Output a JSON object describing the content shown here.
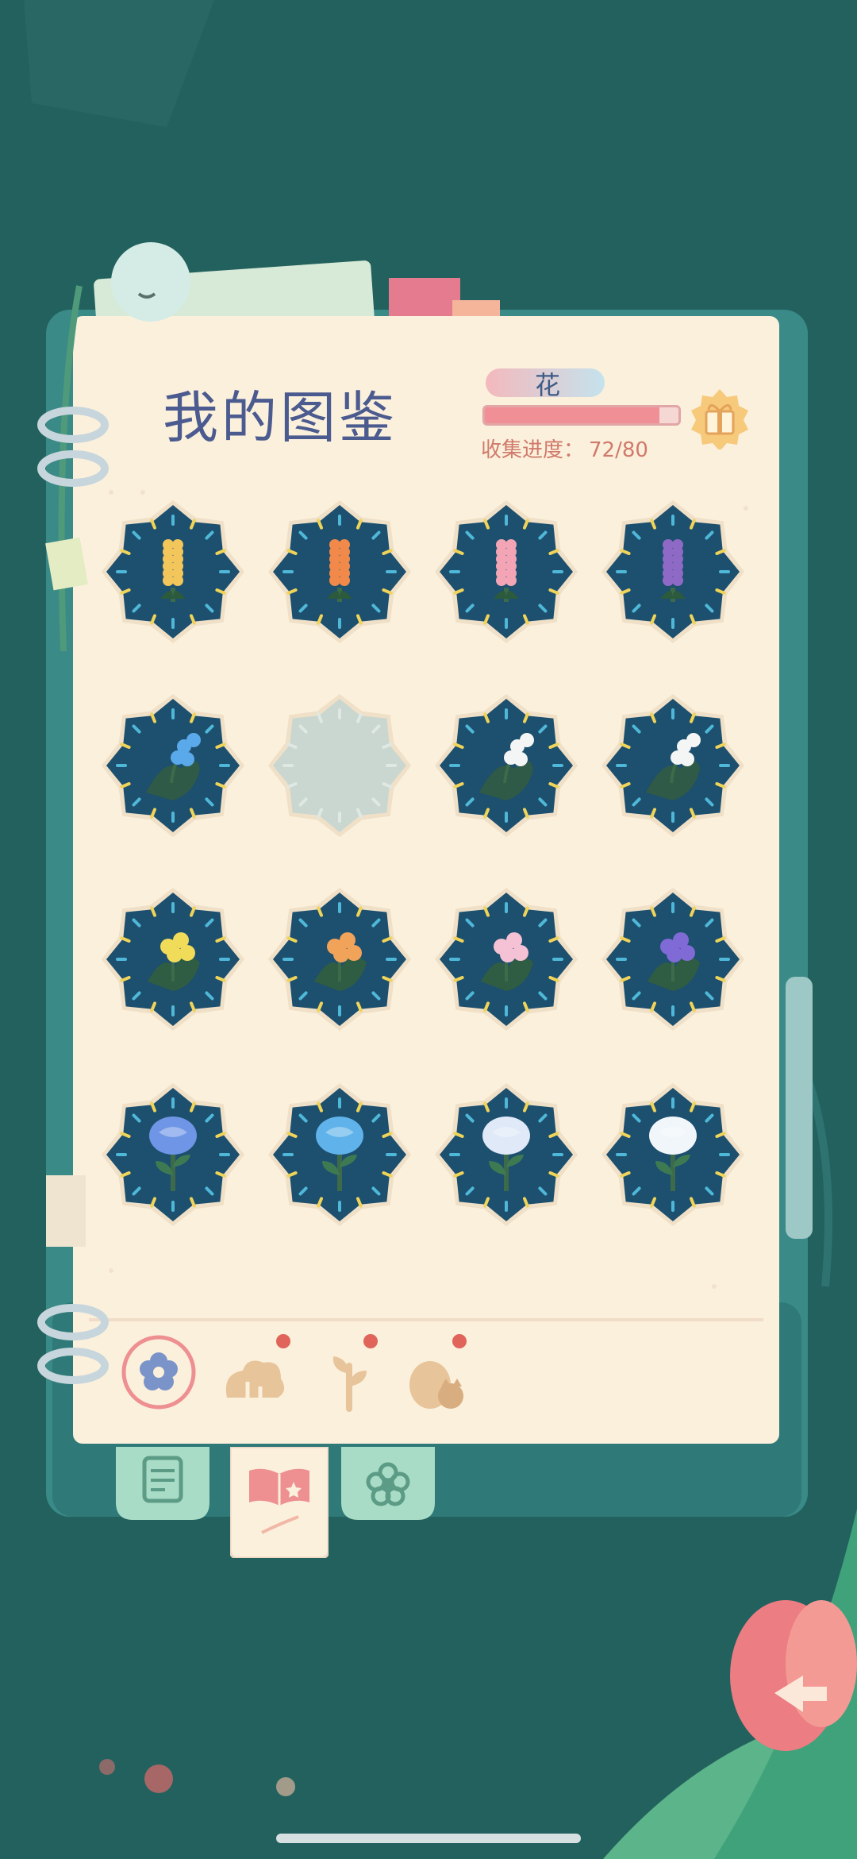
{
  "book": {
    "title": "我的图鉴",
    "category_label": "花",
    "progress_label": "收集进度：",
    "progress_value": "72/80",
    "progress_fraction": 0.9
  },
  "grid": {
    "items": [
      {
        "name": "hyacinth-yellow",
        "kind": "hyacinth",
        "color": "#f2c65a",
        "locked": false
      },
      {
        "name": "hyacinth-orange",
        "kind": "hyacinth",
        "color": "#f0894a",
        "locked": false
      },
      {
        "name": "hyacinth-pink",
        "kind": "hyacinth",
        "color": "#f3a5b5",
        "locked": false
      },
      {
        "name": "hyacinth-purple",
        "kind": "hyacinth",
        "color": "#8e6ac6",
        "locked": false
      },
      {
        "name": "lily-of-valley-blue",
        "kind": "bells",
        "color": "#5aa9ea",
        "locked": false
      },
      {
        "name": "undiscovered",
        "kind": "none",
        "color": "#c9d7d0",
        "locked": true
      },
      {
        "name": "lily-of-valley-white",
        "kind": "bells",
        "color": "#f4f6f5",
        "locked": false
      },
      {
        "name": "lily-of-valley-white-2",
        "kind": "bells",
        "color": "#f4f6f5",
        "locked": false
      },
      {
        "name": "ball-flower-yellow",
        "kind": "balls",
        "color": "#f1dc59",
        "locked": false
      },
      {
        "name": "ball-flower-orange",
        "kind": "balls",
        "color": "#f2a35a",
        "locked": false
      },
      {
        "name": "ball-flower-pink",
        "kind": "balls",
        "color": "#f4c2d4",
        "locked": false
      },
      {
        "name": "ball-flower-purple",
        "kind": "balls",
        "color": "#7f6ad6",
        "locked": false
      },
      {
        "name": "rose-blue",
        "kind": "rose",
        "color": "#6f95e6",
        "locked": false
      },
      {
        "name": "rose-sky",
        "kind": "rose",
        "color": "#5fb3ea",
        "locked": false
      },
      {
        "name": "rose-pale",
        "kind": "rose",
        "color": "#dfe9f8",
        "locked": false
      },
      {
        "name": "rose-white",
        "kind": "rose",
        "color": "#f1f6fb",
        "locked": false
      }
    ]
  },
  "categories": [
    {
      "name": "flower",
      "icon": "flower-icon",
      "active": true,
      "badge": false
    },
    {
      "name": "shrub",
      "icon": "shrub-icon",
      "active": false,
      "badge": true
    },
    {
      "name": "sprout",
      "icon": "sprout-icon",
      "active": false,
      "badge": true
    },
    {
      "name": "animal",
      "icon": "animal-icon",
      "active": false,
      "badge": true
    }
  ],
  "tabs": [
    {
      "name": "notebook",
      "icon": "notebook-icon",
      "active": false
    },
    {
      "name": "collection",
      "icon": "book-star-icon",
      "active": true
    },
    {
      "name": "flower",
      "icon": "flower-tab-icon",
      "active": false
    }
  ],
  "colors": {
    "background": "#1f5c5a",
    "book_cover": "#3c8d8b",
    "page": "#fbf0dc",
    "cell_bg": "#1d4f6e",
    "accent": "#f08f95"
  }
}
